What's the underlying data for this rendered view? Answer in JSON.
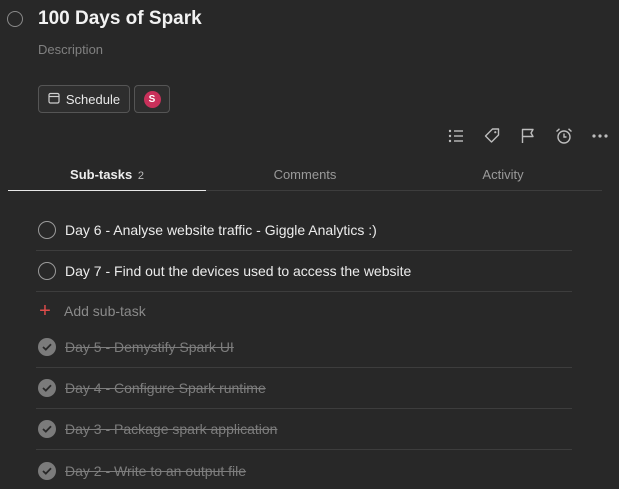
{
  "task": {
    "title": "100 Days of Spark",
    "description_placeholder": "Description"
  },
  "actions": {
    "schedule_label": "Schedule",
    "assignee_initial": "S"
  },
  "toolbar": {
    "icons": [
      "subtasks-list-icon",
      "label-tag-icon",
      "priority-flag-icon",
      "reminder-alarm-icon",
      "more-options-icon"
    ]
  },
  "tabs": [
    {
      "label": "Sub-tasks",
      "count": "2",
      "active": true
    },
    {
      "label": "Comments",
      "count": "",
      "active": false
    },
    {
      "label": "Activity",
      "count": "",
      "active": false
    }
  ],
  "subtasks": {
    "open": [
      {
        "label": "Day 6 - Analyse website traffic - Giggle Analytics :)"
      },
      {
        "label": "Day 7 - Find out the devices used to access the website"
      }
    ],
    "add_label": "Add sub-task",
    "completed": [
      {
        "label": "Day 5 - Demystify Spark UI"
      },
      {
        "label": "Day 4 - Configure Spark runtime"
      },
      {
        "label": "Day 3 - Package spark application"
      },
      {
        "label": "Day 2 - Write to an output file"
      }
    ]
  },
  "colors": {
    "background": "#282828",
    "accent_red": "#de4c4a",
    "avatar": "#c8305a"
  }
}
